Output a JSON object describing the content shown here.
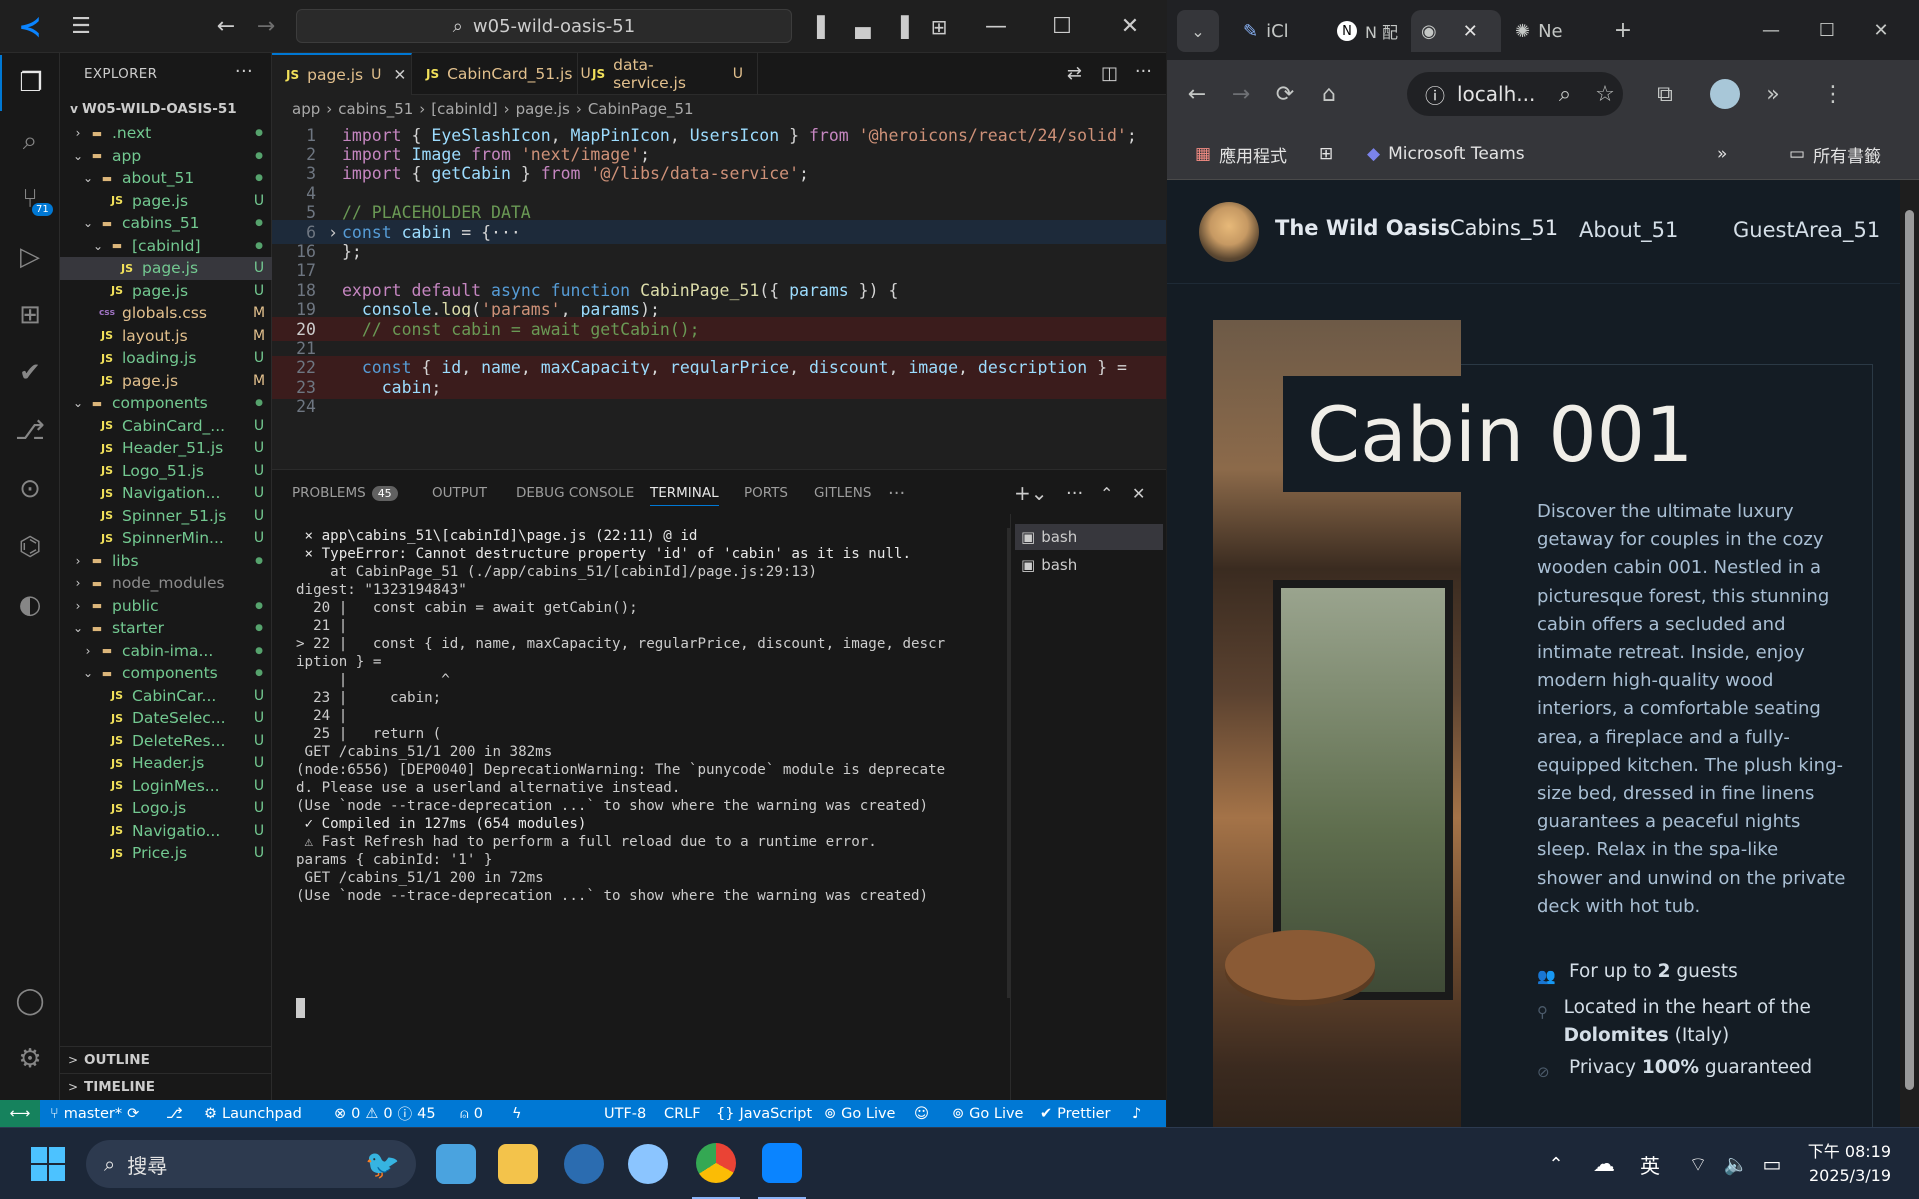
{
  "vscode": {
    "command_center": "w05-wild-oasis-51",
    "explorer_title": "EXPLORER",
    "project_name": "W05-WILD-OASIS-51",
    "tree": [
      {
        "label": ".next",
        "indent": 1,
        "chev": ">",
        "icon": "folder",
        "status": "dot"
      },
      {
        "label": "app",
        "indent": 1,
        "chev": "v",
        "icon": "folder",
        "status": "dot"
      },
      {
        "label": "about_51",
        "indent": 2,
        "chev": "v",
        "icon": "folder",
        "status": "dot"
      },
      {
        "label": "page.js",
        "indent": 3,
        "chev": "",
        "icon": "js",
        "status": "U"
      },
      {
        "label": "cabins_51",
        "indent": 2,
        "chev": "v",
        "icon": "folder",
        "status": "dot"
      },
      {
        "label": "[cabinId]",
        "indent": 3,
        "chev": "v",
        "icon": "folder",
        "status": "dot"
      },
      {
        "label": "page.js",
        "indent": 4,
        "chev": "",
        "icon": "js",
        "status": "U",
        "selected": true
      },
      {
        "label": "page.js",
        "indent": 3,
        "chev": "",
        "icon": "js",
        "status": "U"
      },
      {
        "label": "globals.css",
        "indent": 2,
        "chev": "",
        "icon": "css",
        "status": "M"
      },
      {
        "label": "layout.js",
        "indent": 2,
        "chev": "",
        "icon": "js",
        "status": "M"
      },
      {
        "label": "loading.js",
        "indent": 2,
        "chev": "",
        "icon": "js",
        "status": "U"
      },
      {
        "label": "page.js",
        "indent": 2,
        "chev": "",
        "icon": "js",
        "status": "M"
      },
      {
        "label": "components",
        "indent": 1,
        "chev": "v",
        "icon": "folder",
        "status": "dot"
      },
      {
        "label": "CabinCard_...",
        "indent": 2,
        "chev": "",
        "icon": "js",
        "status": "U"
      },
      {
        "label": "Header_51.js",
        "indent": 2,
        "chev": "",
        "icon": "js",
        "status": "U"
      },
      {
        "label": "Logo_51.js",
        "indent": 2,
        "chev": "",
        "icon": "js",
        "status": "U"
      },
      {
        "label": "Navigation...",
        "indent": 2,
        "chev": "",
        "icon": "js",
        "status": "U"
      },
      {
        "label": "Spinner_51.js",
        "indent": 2,
        "chev": "",
        "icon": "js",
        "status": "U"
      },
      {
        "label": "SpinnerMin...",
        "indent": 2,
        "chev": "",
        "icon": "js",
        "status": "U"
      },
      {
        "label": "libs",
        "indent": 1,
        "chev": ">",
        "icon": "folder",
        "status": "dot"
      },
      {
        "label": "node_modules",
        "indent": 1,
        "chev": ">",
        "icon": "folder",
        "status": ""
      },
      {
        "label": "public",
        "indent": 1,
        "chev": ">",
        "icon": "folder",
        "status": "dot"
      },
      {
        "label": "starter",
        "indent": 1,
        "chev": "v",
        "icon": "folder",
        "status": "dot"
      },
      {
        "label": "cabin-ima...",
        "indent": 2,
        "chev": ">",
        "icon": "folder",
        "status": "dot"
      },
      {
        "label": "components",
        "indent": 2,
        "chev": "v",
        "icon": "folder",
        "status": "dot"
      },
      {
        "label": "CabinCar...",
        "indent": 3,
        "chev": "",
        "icon": "js",
        "status": "U"
      },
      {
        "label": "DateSelec...",
        "indent": 3,
        "chev": "",
        "icon": "js",
        "status": "U"
      },
      {
        "label": "DeleteRes...",
        "indent": 3,
        "chev": "",
        "icon": "js",
        "status": "U"
      },
      {
        "label": "Header.js",
        "indent": 3,
        "chev": "",
        "icon": "js",
        "status": "U"
      },
      {
        "label": "LoginMes...",
        "indent": 3,
        "chev": "",
        "icon": "js",
        "status": "U"
      },
      {
        "label": "Logo.js",
        "indent": 3,
        "chev": "",
        "icon": "js",
        "status": "U"
      },
      {
        "label": "Navigatio...",
        "indent": 3,
        "chev": "",
        "icon": "js",
        "status": "U"
      },
      {
        "label": "Price.js",
        "indent": 3,
        "chev": "",
        "icon": "js",
        "status": "U"
      }
    ],
    "outline_label": "OUTLINE",
    "timeline_label": "TIMELINE",
    "source_control_badge": "71",
    "tabs": [
      {
        "label": "page.js",
        "status": "U",
        "active": true
      },
      {
        "label": "CabinCard_51.js",
        "status": "U"
      },
      {
        "label": "data-service.js",
        "status": "U"
      }
    ],
    "breadcrumb": [
      "app",
      "cabins_51",
      "[cabinId]",
      "page.js",
      "CabinPage_51"
    ],
    "code_lines": [
      {
        "n": "1",
        "segs": [
          [
            "kw2",
            "import"
          ],
          [
            "pl",
            " { "
          ],
          [
            "var",
            "EyeSlashIcon"
          ],
          [
            "pl",
            ", "
          ],
          [
            "var",
            "MapPinIcon"
          ],
          [
            "pl",
            ", "
          ],
          [
            "var",
            "UsersIcon"
          ],
          [
            "pl",
            " } "
          ],
          [
            "kw2",
            "from"
          ],
          [
            "pl",
            " "
          ],
          [
            "str",
            "'@heroicons/react/24/solid'"
          ],
          [
            "pl",
            ";"
          ]
        ]
      },
      {
        "n": "2",
        "segs": [
          [
            "kw2",
            "import"
          ],
          [
            "pl",
            " "
          ],
          [
            "var",
            "Image"
          ],
          [
            "pl",
            " "
          ],
          [
            "kw2",
            "from"
          ],
          [
            "pl",
            " "
          ],
          [
            "str",
            "'next/image'"
          ],
          [
            "pl",
            ";"
          ]
        ]
      },
      {
        "n": "3",
        "segs": [
          [
            "kw2",
            "import"
          ],
          [
            "pl",
            " { "
          ],
          [
            "var",
            "getCabin"
          ],
          [
            "pl",
            " } "
          ],
          [
            "kw2",
            "from"
          ],
          [
            "pl",
            " "
          ],
          [
            "str",
            "'@/libs/data-service'"
          ],
          [
            "pl",
            ";"
          ]
        ]
      },
      {
        "n": "4",
        "segs": []
      },
      {
        "n": "5",
        "segs": [
          [
            "cm",
            "// PLACEHOLDER DATA"
          ]
        ]
      },
      {
        "n": "6",
        "segs": [
          [
            "kw",
            "const"
          ],
          [
            "pl",
            " "
          ],
          [
            "var",
            "cabin"
          ],
          [
            "pl",
            " = {···"
          ]
        ]
      },
      {
        "n": "16",
        "segs": [
          [
            "pl",
            "};"
          ]
        ]
      },
      {
        "n": "17",
        "segs": []
      },
      {
        "n": "18",
        "segs": [
          [
            "kw2",
            "export"
          ],
          [
            "pl",
            " "
          ],
          [
            "kw2",
            "default"
          ],
          [
            "pl",
            " "
          ],
          [
            "kw",
            "async"
          ],
          [
            "pl",
            " "
          ],
          [
            "kw",
            "function"
          ],
          [
            "pl",
            " "
          ],
          [
            "fn",
            "CabinPage_51"
          ],
          [
            "pl",
            "({ "
          ],
          [
            "var",
            "params"
          ],
          [
            "pl",
            " }) {"
          ]
        ]
      },
      {
        "n": "19",
        "segs": [
          [
            "pl",
            "  "
          ],
          [
            "var",
            "console"
          ],
          [
            "pl",
            "."
          ],
          [
            "fn",
            "log"
          ],
          [
            "pl",
            "("
          ],
          [
            "str",
            "'params'"
          ],
          [
            "pl",
            ", "
          ],
          [
            "var",
            "params"
          ],
          [
            "pl",
            ");"
          ]
        ]
      },
      {
        "n": "20",
        "segs": [
          [
            "cm",
            "  // const cabin = await getCabin();"
          ]
        ]
      },
      {
        "n": "21",
        "segs": []
      },
      {
        "n": "22",
        "segs": [
          [
            "pl",
            "  "
          ],
          [
            "kw",
            "const"
          ],
          [
            "pl",
            " { "
          ],
          [
            "var",
            "id"
          ],
          [
            "pl",
            ", "
          ],
          [
            "var",
            "name"
          ],
          [
            "pl",
            ", "
          ],
          [
            "var",
            "maxCapacity"
          ],
          [
            "pl",
            ", "
          ],
          [
            "var",
            "regularPrice"
          ],
          [
            "pl",
            ", "
          ],
          [
            "var",
            "discount"
          ],
          [
            "pl",
            ", "
          ],
          [
            "var",
            "image"
          ],
          [
            "pl",
            ", "
          ],
          [
            "var",
            "description"
          ],
          [
            "pl",
            " } ="
          ]
        ]
      },
      {
        "n": "23",
        "segs": [
          [
            "pl",
            "    "
          ],
          [
            "var",
            "cabin"
          ],
          [
            "pl",
            ";"
          ]
        ]
      },
      {
        "n": "24",
        "segs": []
      }
    ],
    "panel_tabs": [
      "PROBLEMS",
      "OUTPUT",
      "DEBUG CONSOLE",
      "TERMINAL",
      "PORTS",
      "GITLENS"
    ],
    "problems_count": "45",
    "terminal_lines": [
      " ⨯ app\\cabins_51\\[cabinId]\\page.js (22:11) @ id",
      " ⨯ TypeError: Cannot destructure property 'id' of 'cabin' as it is null.",
      "    at CabinPage_51 (./app/cabins_51/[cabinId]/page.js:29:13)",
      "digest: \"1323194843\"",
      "  20 |   const cabin = await getCabin();",
      "  21 |",
      "> 22 |   const { id, name, maxCapacity, regularPrice, discount, image, descr",
      "iption } =",
      "     |           ^",
      "  23 |     cabin;",
      "  24 |",
      "  25 |   return (",
      " GET /cabins_51/1 200 in 382ms",
      "(node:6556) [DEP0040] DeprecationWarning: The `punycode` module is deprecate",
      "d. Please use a userland alternative instead.",
      "(Use `node --trace-deprecation ...` to show where the warning was created)",
      " ✓ Compiled in 127ms (654 modules)",
      " ⚠ Fast Refresh had to perform a full reload due to a runtime error.",
      "params { cabinId: '1' }",
      " GET /cabins_51/1 200 in 72ms",
      "(Use `node --trace-deprecation ...` to show where the warning was created)"
    ],
    "terminals": [
      "bash",
      "bash"
    ],
    "status": {
      "branch": "master*",
      "launchpad": "Launchpad",
      "errors": "0",
      "warnings": "0",
      "infos": "45",
      "ports": "0",
      "encoding": "UTF-8",
      "eol": "CRLF",
      "language": "JavaScript",
      "golive1": "Go Live",
      "golive2": "Go Live",
      "prettier": "Prettier"
    }
  },
  "chrome": {
    "tabs": [
      {
        "label": "iCl"
      },
      {
        "label": "N 配"
      },
      {
        "label": "",
        "active": true
      },
      {
        "label": "Ne"
      }
    ],
    "url": "localh...",
    "bookmarks": [
      {
        "label": "應用程式"
      },
      {
        "label": "Microsoft Teams"
      }
    ],
    "all_bookmarks": "所有書籤",
    "site": {
      "brand": "The Wild Oasis",
      "nav": [
        "Cabins_51",
        "About_51",
        "GuestArea_51"
      ],
      "cabin_title": "Cabin 001",
      "description": "Discover the ultimate luxury getaway for couples in the cozy wooden cabin 001. Nestled in a picturesque forest, this stunning cabin offers a secluded and intimate retreat. Inside, enjoy modern high-quality wood interiors, a comfortable seating area, a fireplace and a fully-equipped kitchen. The plush king-size bed, dressed in fine linens guarantees a peaceful nights sleep. Relax in the spa-like shower and unwind on the private deck with hot tub.",
      "guests_prefix": "For up to ",
      "guests_num": "2",
      "guests_suffix": " guests",
      "location_prefix": "Located in the heart of the ",
      "location_bold": "Dolomites",
      "location_suffix": " (Italy)",
      "privacy_prefix": "Privacy ",
      "privacy_bold": "100%",
      "privacy_suffix": " guaranteed"
    }
  },
  "taskbar": {
    "search": "搜尋",
    "ime": "英",
    "time": "下午 08:19",
    "date": "2025/3/19"
  },
  "colors": {
    "vscode_accent": "#0078d4",
    "site_bg": "#141c24",
    "site_accent": "#c69963"
  }
}
